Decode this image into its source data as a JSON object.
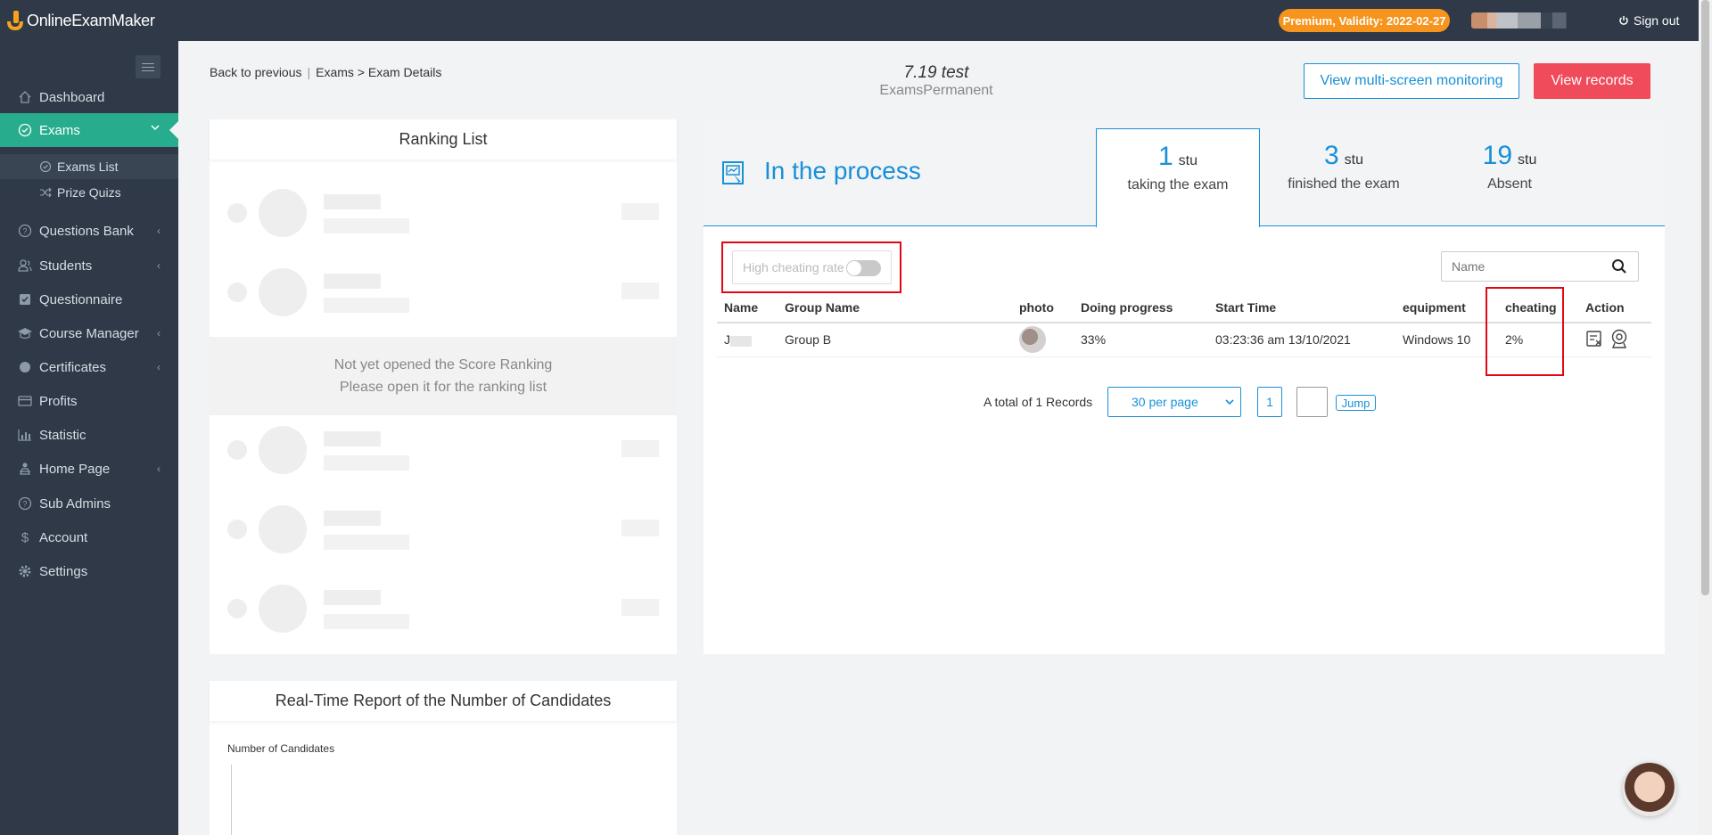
{
  "app": {
    "logo_text": "OnlineExamMaker",
    "premium_badge": "Premium, Validity: 2022-02-27",
    "sign_out": "Sign out"
  },
  "sidebar": {
    "items": [
      {
        "label": "Dashboard",
        "icon": "home-icon"
      },
      {
        "label": "Exams",
        "icon": "check-circle-icon",
        "active": true
      },
      {
        "label": "Questions Bank",
        "icon": "question-circle-icon"
      },
      {
        "label": "Students",
        "icon": "users-icon"
      },
      {
        "label": "Questionnaire",
        "icon": "checkbox-icon"
      },
      {
        "label": "Course Manager",
        "icon": "graduation-cap-icon"
      },
      {
        "label": "Certificates",
        "icon": "certificate-icon"
      },
      {
        "label": "Profits",
        "icon": "credit-card-icon"
      },
      {
        "label": "Statistic",
        "icon": "bar-chart-icon"
      },
      {
        "label": "Home Page",
        "icon": "home-page-icon"
      },
      {
        "label": "Sub Admins",
        "icon": "question-circle-icon"
      },
      {
        "label": "Account",
        "icon": "dollar-icon"
      },
      {
        "label": "Settings",
        "icon": "gear-icon"
      }
    ],
    "sub_items": [
      {
        "label": "Exams List",
        "icon": "check-circle-icon",
        "selected": true
      },
      {
        "label": "Prize Quizs",
        "icon": "shuffle-icon"
      }
    ]
  },
  "breadcrumb": {
    "back": "Back to previous",
    "separator": "|",
    "path": "Exams > Exam Details"
  },
  "exam": {
    "title": "7.19 test",
    "subtitle": "ExamsPermanent"
  },
  "actions": {
    "monitor": "View multi-screen monitoring",
    "records": "View records"
  },
  "ranking": {
    "title": "Ranking List",
    "empty_line1": "Not yet opened the Score Ranking",
    "empty_line2": "Please open it for the ranking list"
  },
  "realtime": {
    "title": "Real-Time Report of the Number of Candidates",
    "y_label": "Number of Candidates"
  },
  "process": {
    "status": "In the process",
    "stats": [
      {
        "num": "1",
        "unit": "stu",
        "label": "taking the exam"
      },
      {
        "num": "3",
        "unit": "stu",
        "label": "finished the exam"
      },
      {
        "num": "19",
        "unit": "stu",
        "label": "Absent"
      }
    ],
    "toggle_label": "High cheating rate",
    "search_placeholder": "Name"
  },
  "table": {
    "headers": [
      "Name",
      "Group Name",
      "photo",
      "Doing progress",
      "Start Time",
      "equipment",
      "cheating",
      "Action"
    ],
    "rows": [
      {
        "name": "J",
        "group": "Group B",
        "progress": "33%",
        "start_time": "03:23:36 am 13/10/2021",
        "equipment": "Windows 10",
        "cheating": "2%"
      }
    ]
  },
  "pager": {
    "total": "A total of 1 Records",
    "per_page": "30 per page",
    "page": "1",
    "jump": "Jump"
  },
  "colors": {
    "accent": "#1890d8",
    "active_green": "#27ad8d",
    "danger": "#ef4b5b",
    "premium": "#f7941d",
    "cheating_text": "#27b80d",
    "highlight_box": "#e30613"
  }
}
